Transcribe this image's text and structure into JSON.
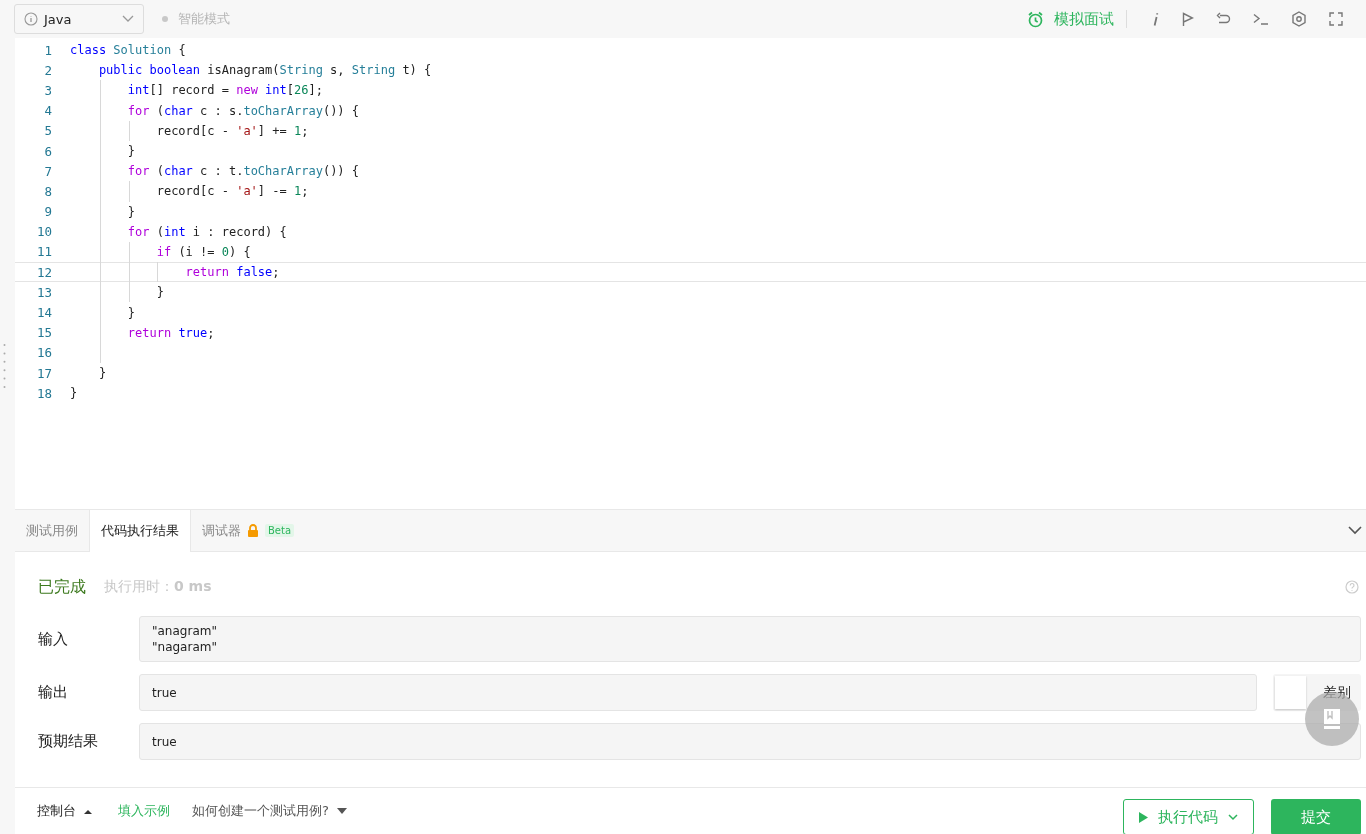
{
  "toolbar": {
    "language": "Java",
    "mode_label": "智能模式",
    "interview_label": "模拟面试"
  },
  "editor": {
    "lines": [
      {
        "number": "1",
        "current": false,
        "tokens": [
          {
            "kind": "kw",
            "text": "class"
          },
          {
            "kind": "type",
            "text": " Solution"
          },
          {
            "kind": "p",
            "text": " {"
          }
        ]
      },
      {
        "number": "2",
        "current": false,
        "tokens": [
          {
            "kind": "kw",
            "text": "    public"
          },
          {
            "kind": "kw",
            "text": " boolean"
          },
          {
            "kind": "p",
            "text": " isAnagram("
          },
          {
            "kind": "type",
            "text": "String"
          },
          {
            "kind": "p",
            "text": " s, "
          },
          {
            "kind": "type",
            "text": "String"
          },
          {
            "kind": "p",
            "text": " t) {"
          }
        ]
      },
      {
        "number": "3",
        "current": false,
        "tokens": [
          {
            "kind": "kw",
            "text": "        int"
          },
          {
            "kind": "p",
            "text": "[] record = "
          },
          {
            "kind": "ctl",
            "text": "new"
          },
          {
            "kind": "kw",
            "text": " int"
          },
          {
            "kind": "p",
            "text": "["
          },
          {
            "kind": "num",
            "text": "26"
          },
          {
            "kind": "p",
            "text": "];"
          }
        ]
      },
      {
        "number": "4",
        "current": false,
        "tokens": [
          {
            "kind": "ctl",
            "text": "        for"
          },
          {
            "kind": "p",
            "text": " ("
          },
          {
            "kind": "kw",
            "text": "char"
          },
          {
            "kind": "p",
            "text": " c : s."
          },
          {
            "kind": "fn",
            "text": "toCharArray"
          },
          {
            "kind": "p",
            "text": "()) {"
          }
        ]
      },
      {
        "number": "5",
        "current": false,
        "tokens": [
          {
            "kind": "p",
            "text": "            record[c - "
          },
          {
            "kind": "str",
            "text": "'a'"
          },
          {
            "kind": "p",
            "text": "] += "
          },
          {
            "kind": "num",
            "text": "1"
          },
          {
            "kind": "p",
            "text": ";"
          }
        ]
      },
      {
        "number": "6",
        "current": false,
        "tokens": [
          {
            "kind": "p",
            "text": "        }"
          }
        ]
      },
      {
        "number": "7",
        "current": false,
        "tokens": [
          {
            "kind": "ctl",
            "text": "        for"
          },
          {
            "kind": "p",
            "text": " ("
          },
          {
            "kind": "kw",
            "text": "char"
          },
          {
            "kind": "p",
            "text": " c : t."
          },
          {
            "kind": "fn",
            "text": "toCharArray"
          },
          {
            "kind": "p",
            "text": "()) {"
          }
        ]
      },
      {
        "number": "8",
        "current": false,
        "tokens": [
          {
            "kind": "p",
            "text": "            record[c - "
          },
          {
            "kind": "str",
            "text": "'a'"
          },
          {
            "kind": "p",
            "text": "] -= "
          },
          {
            "kind": "num",
            "text": "1"
          },
          {
            "kind": "p",
            "text": ";"
          }
        ]
      },
      {
        "number": "9",
        "current": false,
        "tokens": [
          {
            "kind": "p",
            "text": "        }"
          }
        ]
      },
      {
        "number": "10",
        "current": false,
        "tokens": [
          {
            "kind": "ctl",
            "text": "        for"
          },
          {
            "kind": "p",
            "text": " ("
          },
          {
            "kind": "kw",
            "text": "int"
          },
          {
            "kind": "p",
            "text": " i : record) {"
          }
        ]
      },
      {
        "number": "11",
        "current": false,
        "tokens": [
          {
            "kind": "ctl",
            "text": "            if"
          },
          {
            "kind": "p",
            "text": " (i != "
          },
          {
            "kind": "num",
            "text": "0"
          },
          {
            "kind": "p",
            "text": ") {"
          }
        ]
      },
      {
        "number": "12",
        "current": true,
        "tokens": [
          {
            "kind": "ctl",
            "text": "                return"
          },
          {
            "kind": "kw",
            "text": " false"
          },
          {
            "kind": "p",
            "text": ";"
          }
        ]
      },
      {
        "number": "13",
        "current": false,
        "tokens": [
          {
            "kind": "p",
            "text": "            }"
          }
        ]
      },
      {
        "number": "14",
        "current": false,
        "tokens": [
          {
            "kind": "p",
            "text": "        }"
          }
        ]
      },
      {
        "number": "15",
        "current": false,
        "tokens": [
          {
            "kind": "ctl",
            "text": "        return"
          },
          {
            "kind": "kw",
            "text": " true"
          },
          {
            "kind": "p",
            "text": ";"
          }
        ]
      },
      {
        "number": "16",
        "current": false
      },
      {
        "number": "17",
        "current": false,
        "tokens": [
          {
            "kind": "p",
            "text": "    }"
          }
        ]
      },
      {
        "number": "18",
        "current": false,
        "tokens": [
          {
            "kind": "p",
            "text": "}"
          }
        ]
      }
    ]
  },
  "bottom_panel": {
    "tabs": [
      {
        "label": "测试用例",
        "selected": false,
        "locked": false
      },
      {
        "label": "代码执行结果",
        "selected": true,
        "locked": false
      },
      {
        "label": "调试器",
        "selected": false,
        "locked": true,
        "badge": "Beta"
      }
    ],
    "status": "已完成",
    "runtime": "执行用时：**0 ms**",
    "fields": [
      {
        "label": "输入",
        "lines": [
          "\"anagram\"",
          "\"nagaram\""
        ]
      },
      {
        "label": "输出",
        "lines": [
          "true"
        ],
        "diff_toggle": {
          "label": "差别",
          "on": false
        }
      },
      {
        "label": "预期结果",
        "lines": [
          "true"
        ]
      }
    ]
  },
  "footer": {
    "console": "控制台",
    "fill_example": "填入示例",
    "howto": "如何创建一个测试用例?",
    "run": "执行代码",
    "submit": "提交"
  }
}
